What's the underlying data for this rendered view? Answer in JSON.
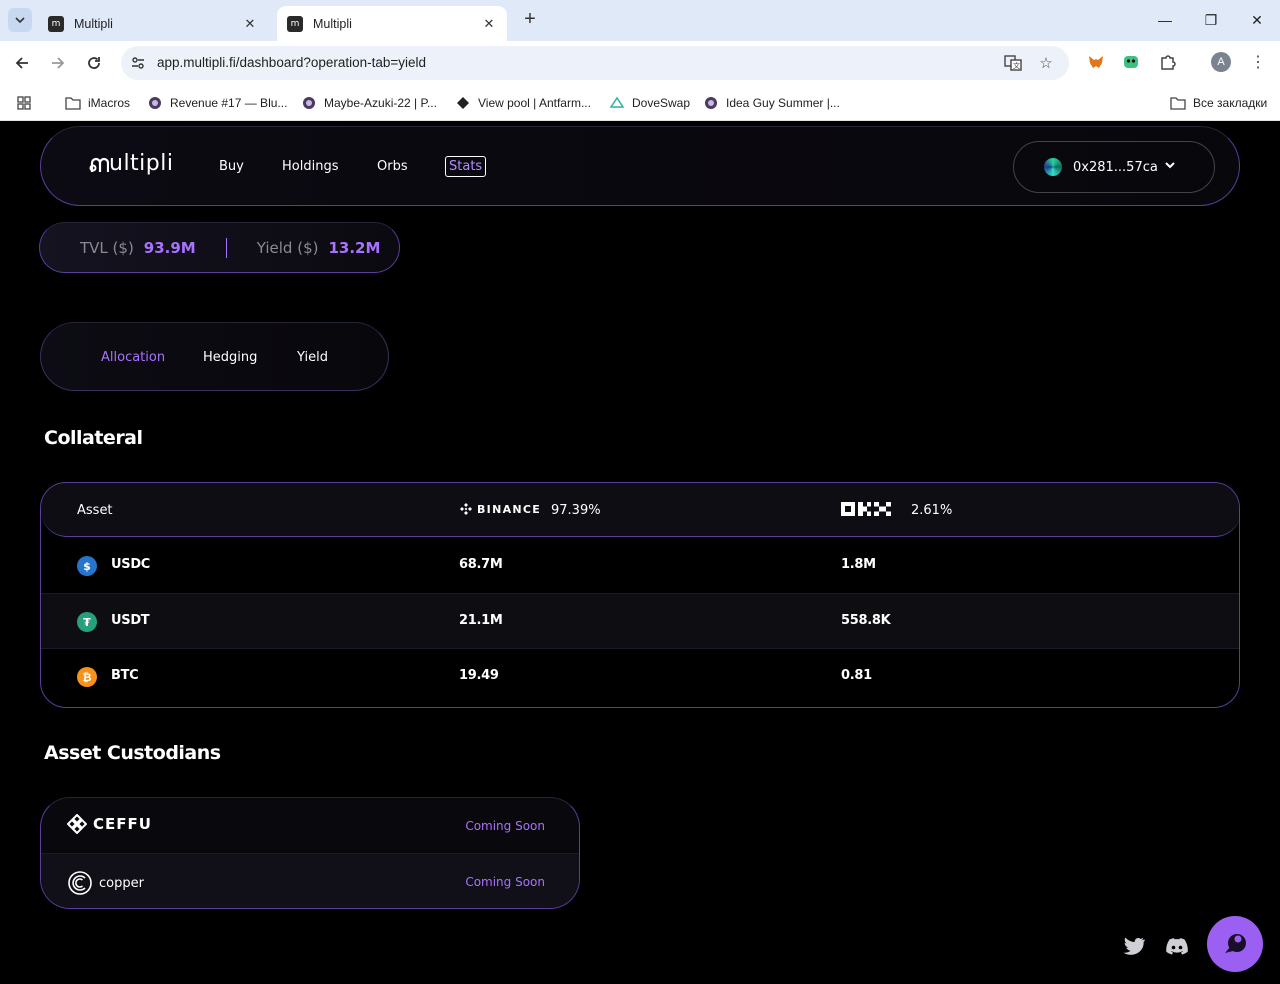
{
  "browser": {
    "tabs": [
      {
        "title": "Multipli",
        "favicon": "multipli-favicon",
        "active": false
      },
      {
        "title": "Multipli",
        "favicon": "multipli-favicon",
        "active": true
      }
    ],
    "url": "app.multipli.fi/dashboard?operation-tab=yield",
    "profile_initial": "A",
    "bookmarks": [
      {
        "label": "iMacros",
        "icon": "folder-icon"
      },
      {
        "label": "Revenue #17 — Blu...",
        "icon": "site-icon"
      },
      {
        "label": "Maybe-Azuki-22 | P...",
        "icon": "site-icon"
      },
      {
        "label": "View pool | Antfarm...",
        "icon": "site-icon"
      },
      {
        "label": "DoveSwap",
        "icon": "site-icon"
      },
      {
        "label": "Idea Guy Summer |...",
        "icon": "site-icon"
      }
    ],
    "all_bookmarks": "Все закладки"
  },
  "app": {
    "logo_text": "ultipli",
    "nav": [
      "Buy",
      "Holdings",
      "Orbs",
      "Stats"
    ],
    "active_nav": "Stats",
    "wallet": "0x281...57ca",
    "stats": {
      "tvl_label": "TVL ($)",
      "tvl_value": "93.9M",
      "yield_label": "Yield ($)",
      "yield_value": "13.2M"
    },
    "operation_tabs": [
      "Allocation",
      "Hedging",
      "Yield"
    ],
    "active_operation_tab": "Allocation",
    "collateral": {
      "title": "Collateral",
      "header": {
        "asset": "Asset",
        "binance_label": "BINANCE",
        "binance_pct": "97.39%",
        "okx_pct": "2.61%"
      },
      "rows": [
        {
          "asset": "USDC",
          "icon": "usdc-icon",
          "color": "#2775ca",
          "glyph": "$",
          "binance": "68.7M",
          "okx": "1.8M"
        },
        {
          "asset": "USDT",
          "icon": "usdt-icon",
          "color": "#26a17b",
          "glyph": "₮",
          "binance": "21.1M",
          "okx": "558.8K"
        },
        {
          "asset": "BTC",
          "icon": "btc-icon",
          "color": "#f7931a",
          "glyph": "₿",
          "binance": "19.49",
          "okx": "0.81"
        }
      ]
    },
    "custodians": {
      "title": "Asset Custodians",
      "rows": [
        {
          "name": "CEFFU",
          "status": "Coming Soon"
        },
        {
          "name": "copper",
          "status": "Coming Soon"
        }
      ]
    },
    "colors": {
      "accent": "#a872ff",
      "chat_button": "#9b5ff2",
      "border": "#5b3d9a"
    }
  }
}
